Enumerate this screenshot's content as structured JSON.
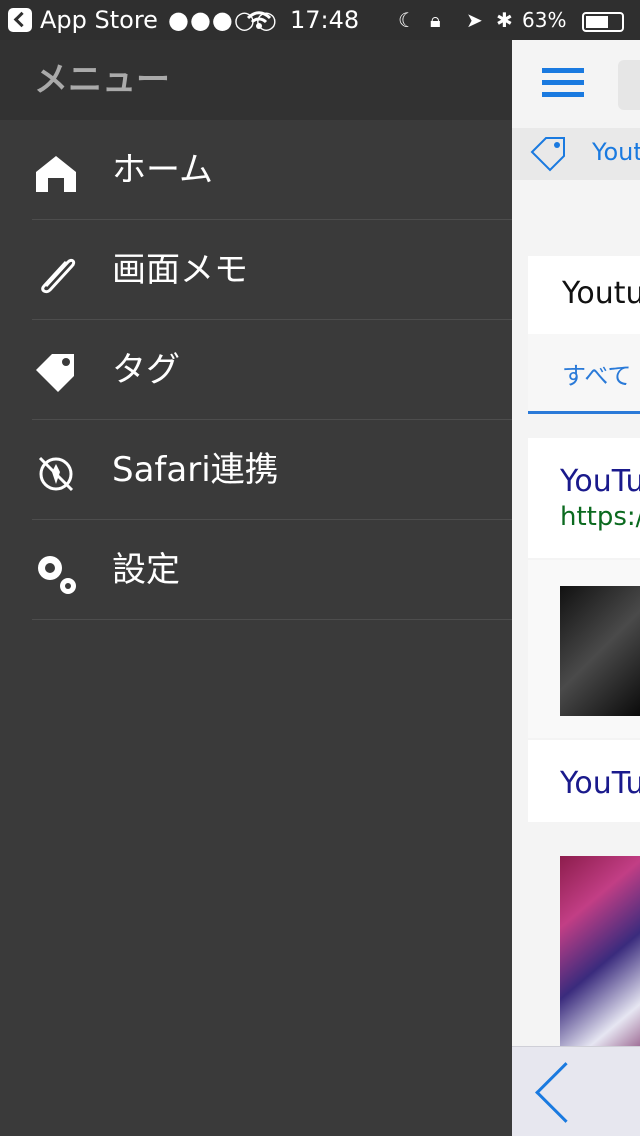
{
  "status_bar": {
    "app": "App Store",
    "signal": "●●●○○",
    "time": "17:48",
    "battery": "63%"
  },
  "menu": {
    "title": "メニュー",
    "items": [
      {
        "label": "ホーム",
        "icon": "home-icon"
      },
      {
        "label": "画面メモ",
        "icon": "paperclip-icon"
      },
      {
        "label": "タグ",
        "icon": "tag-icon"
      },
      {
        "label": "Safari連携",
        "icon": "safari-icon"
      },
      {
        "label": "設定",
        "icon": "gear-icon"
      }
    ]
  },
  "content": {
    "tag_text": "Yout",
    "section_title": "Youtu",
    "tab_all": "すべて",
    "results": [
      {
        "title": "YouTu",
        "url": "https:/"
      },
      {
        "title": "YouTu"
      }
    ]
  },
  "colors": {
    "accent": "#1a7ae0",
    "menu_bg": "#3a3a3a",
    "menu_header": "#323232",
    "result_title": "#1a1a8c",
    "result_url": "#0b6a1f"
  }
}
